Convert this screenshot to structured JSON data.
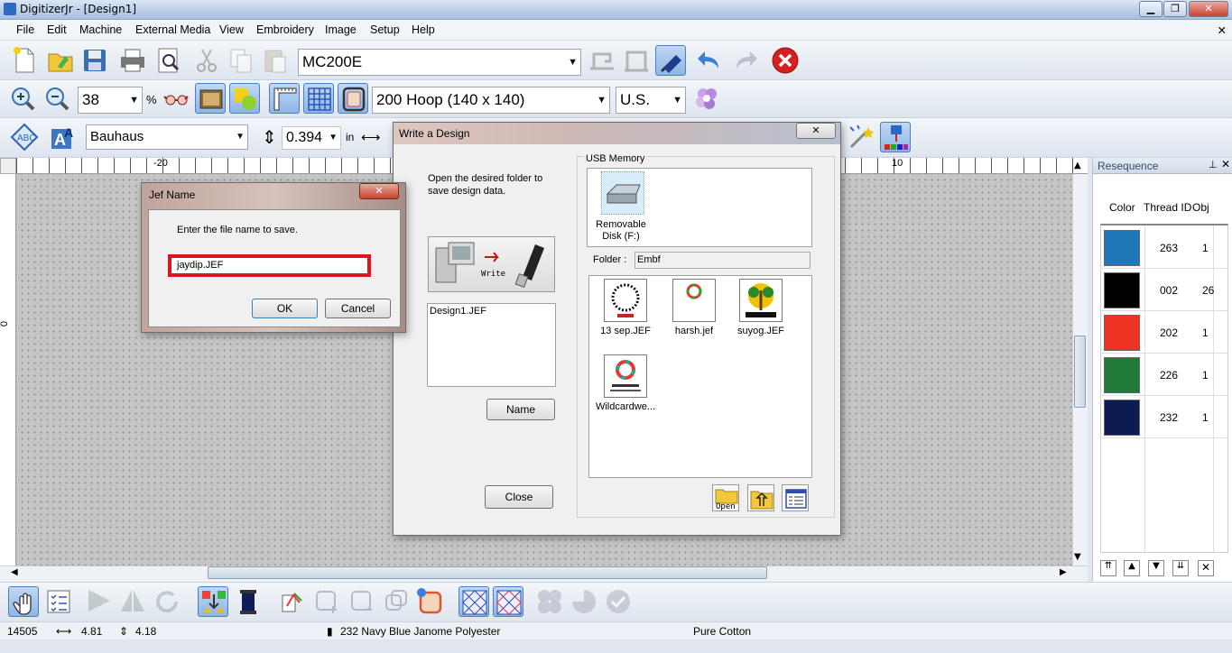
{
  "window": {
    "title": "DigitizerJr - [Design1]"
  },
  "menu": [
    "File",
    "Edit",
    "Machine",
    "External Media",
    "View",
    "Embroidery",
    "Image",
    "Setup",
    "Help"
  ],
  "toolbar1": {
    "machine": "MC200E"
  },
  "toolbar2": {
    "zoom": "38",
    "zoom_unit": "%",
    "hoop": "200 Hoop (140 x 140)",
    "units": "U.S."
  },
  "toolbar3": {
    "font": "Bauhaus",
    "size": "0.394",
    "size_unit": "in"
  },
  "ruler": {
    "h_left": "-20",
    "h_right": "10",
    "v_zero": "0"
  },
  "resequence": {
    "title": "Resequence",
    "headers": {
      "color": "Color",
      "thread": "Thread ID",
      "obj": "Obj"
    },
    "rows": [
      {
        "color": "#1f78b8",
        "thread": "263",
        "obj": "1"
      },
      {
        "color": "#000000",
        "thread": "002",
        "obj": "26"
      },
      {
        "color": "#ee3322",
        "thread": "202",
        "obj": "1"
      },
      {
        "color": "#1f7a3a",
        "thread": "226",
        "obj": "1"
      },
      {
        "color": "#0d1b52",
        "thread": "232",
        "obj": "1"
      }
    ]
  },
  "status": {
    "stitches": "14505",
    "width": "4.81",
    "height": "4.18",
    "thread": "232 Navy Blue Janome Polyester",
    "fabric": "Pure Cotton"
  },
  "write_dialog": {
    "title": "Write a Design",
    "instructions": "Open the desired folder to save design data.",
    "write_label": "Write",
    "current_file": "Design1.JEF",
    "name_button": "Name",
    "close_button": "Close",
    "usb_group": "USB Memory",
    "drive_label": "Removable Disk (F:)",
    "folder_label": "Folder :",
    "folder_value": "Embf",
    "files": [
      "13 sep.JEF",
      "harsh.jef",
      "suyog.JEF",
      "Wildcardwe..."
    ],
    "open_label": "Open"
  },
  "jef_dialog": {
    "title": "Jef Name",
    "prompt": "Enter the file name to save.",
    "filename": "jaydip.JEF",
    "ok": "OK",
    "cancel": "Cancel"
  }
}
